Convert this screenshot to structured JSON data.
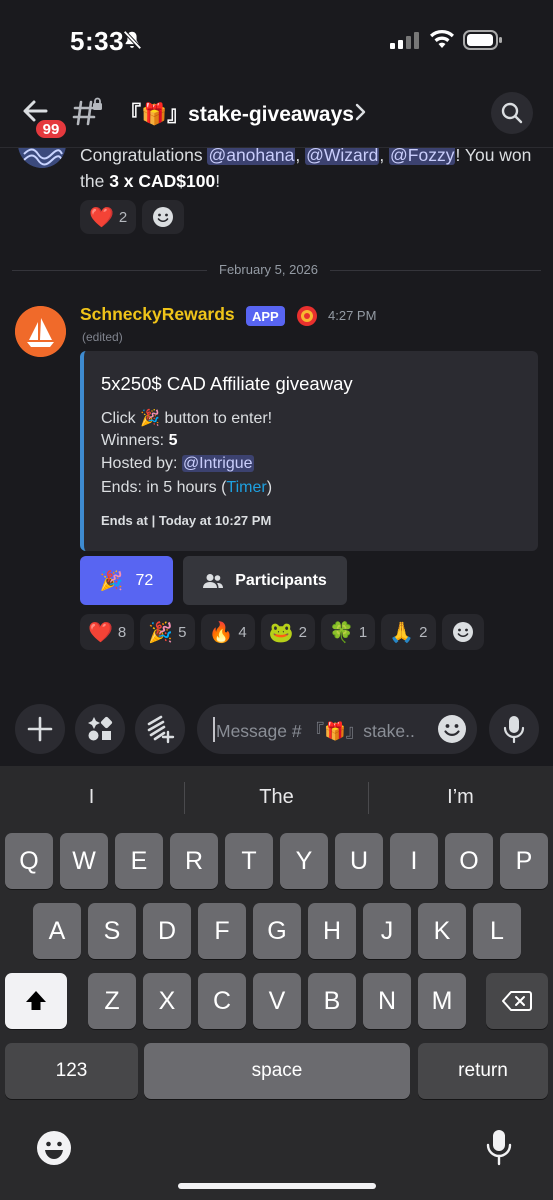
{
  "status_bar": {
    "time": "5:33"
  },
  "header": {
    "unread_badge": "99",
    "channel_name": "『🎁』stake-giveaways"
  },
  "previous_message": {
    "text_prefix": "Congratulations ",
    "mentions": [
      "@anohana",
      "@Wizard",
      "@Fozzy"
    ],
    "text_suffix": "! You won the ",
    "prize": "3 x CAD$100",
    "text_end": "!",
    "reactions": [
      {
        "emoji": "❤️",
        "count": "2"
      }
    ]
  },
  "date_divider": "February 5, 2026",
  "message": {
    "author": "SchneckyRewards",
    "app_tag": "APP",
    "time": "4:27 PM",
    "edited": "(edited)",
    "embed": {
      "title": "5x250$ CAD Affiliate giveaway",
      "click_prefix": "Click ",
      "click_emoji": "🎉",
      "click_suffix": " button to enter!",
      "winners_label": "Winners: ",
      "winners_value": "5",
      "hosted_label": "Hosted by: ",
      "hosted_value": "@Intrigue",
      "ends_label": "Ends: in 5 hours (",
      "ends_link": "Timer",
      "ends_close": ")",
      "footer": "Ends at | Today at 10:27 PM",
      "accent_color": "#3e8bd0"
    },
    "buttons": {
      "enter_emoji": "🎉",
      "enter_count": "72",
      "participants_label": "Participants"
    },
    "reactions": [
      {
        "emoji": "❤️",
        "count": "8"
      },
      {
        "emoji": "🎉",
        "count": "5"
      },
      {
        "emoji": "🔥",
        "count": "4"
      },
      {
        "emoji": "🐸",
        "count": "2"
      },
      {
        "emoji": "🍀",
        "count": "1"
      },
      {
        "emoji": "🙏",
        "count": "2"
      }
    ]
  },
  "composer": {
    "placeholder": "Message # 『🎁』stake.."
  },
  "keyboard": {
    "suggestions": [
      "I",
      "The",
      "I’m"
    ],
    "row1": [
      "Q",
      "W",
      "E",
      "R",
      "T",
      "Y",
      "U",
      "I",
      "O",
      "P"
    ],
    "row2": [
      "A",
      "S",
      "D",
      "F",
      "G",
      "H",
      "J",
      "K",
      "L"
    ],
    "row3": [
      "Z",
      "X",
      "C",
      "V",
      "B",
      "N",
      "M"
    ],
    "numbers_key": "123",
    "space_key": "space",
    "return_key": "return"
  },
  "colors": {
    "blurple": "#5865f2",
    "username": "#f0c419",
    "badge": "#e5393e",
    "link": "#1ea0e0"
  }
}
